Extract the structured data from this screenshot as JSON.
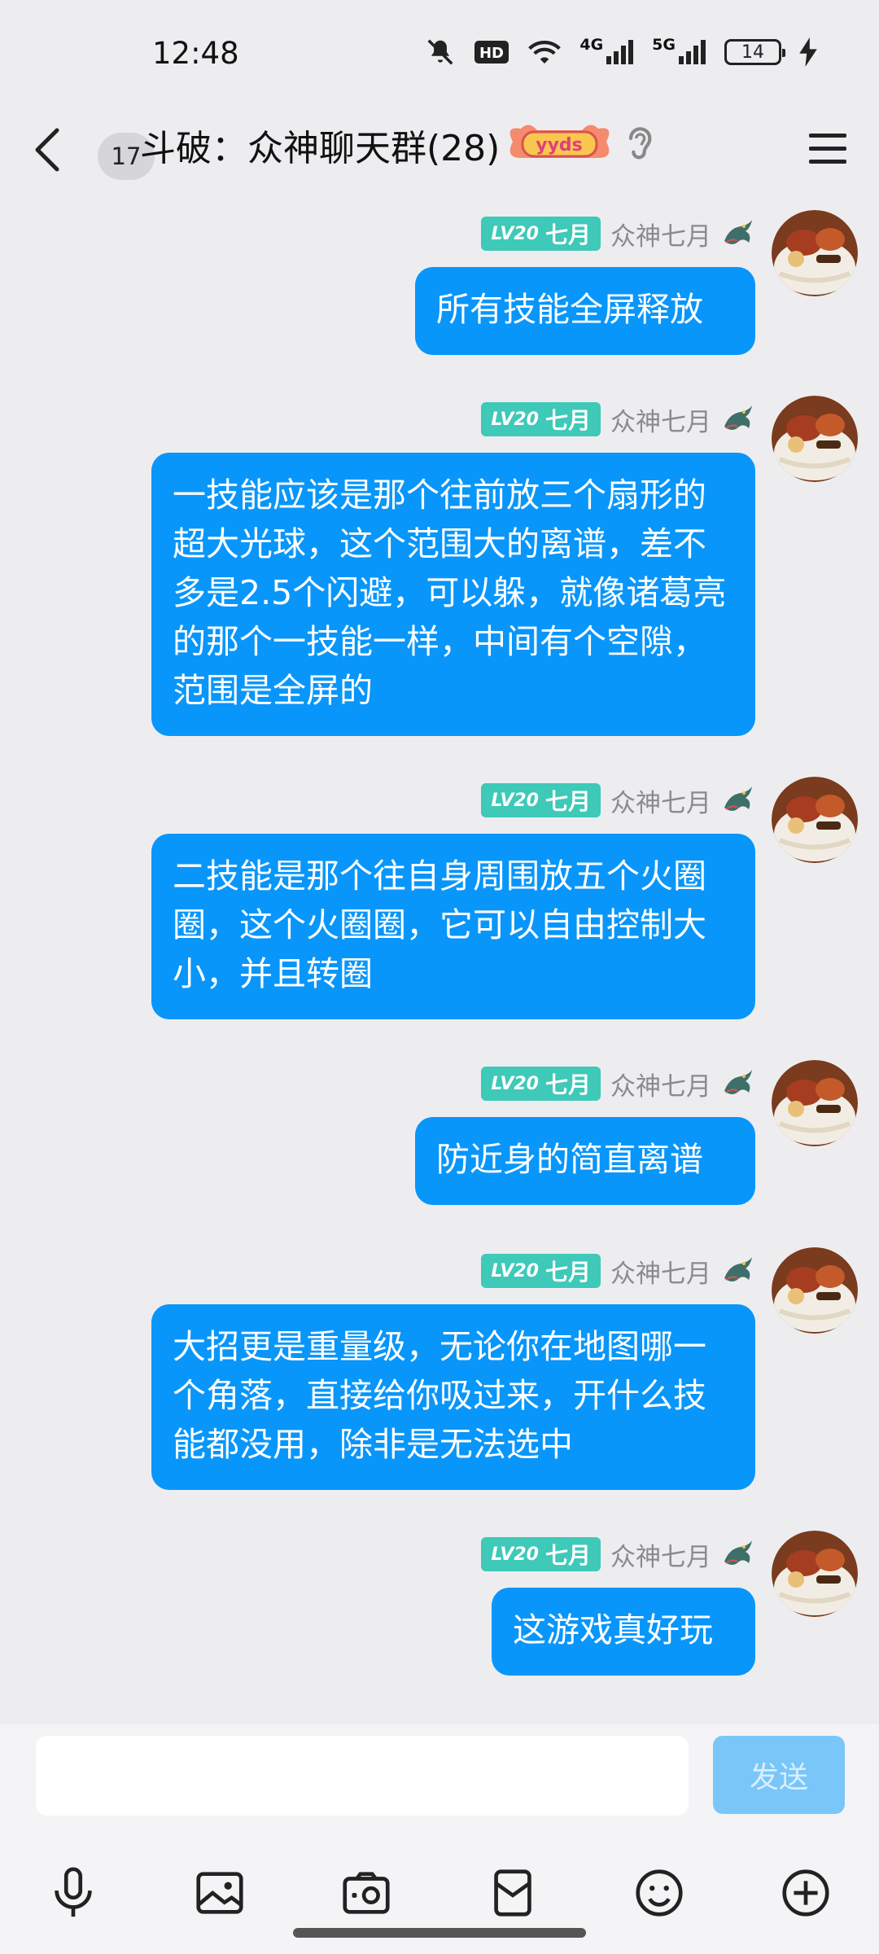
{
  "status_bar": {
    "time": "12:48",
    "icons": [
      "mute-icon",
      "hd-icon",
      "wifi-icon",
      "signal-4g-icon",
      "signal-5g-icon",
      "battery-icon",
      "charging-icon"
    ],
    "net1": "4G",
    "net2": "5G",
    "battery": "14"
  },
  "header": {
    "unread_count": "17",
    "title": "斗破：众神聊天群(28)",
    "badge_icon": "yyds-badge-icon",
    "ear_icon": "ear-icon",
    "menu_icon": "menu-icon"
  },
  "messages": [
    {
      "lv": "LV20",
      "title": "七月",
      "sender": "众神七月",
      "text": "所有技能全屏释放"
    },
    {
      "lv": "LV20",
      "title": "七月",
      "sender": "众神七月",
      "text": "一技能应该是那个往前放三个扇形的超大光球，这个范围大的离谱，差不多是2.5个闪避，可以躲，就像诸葛亮的那个一技能一样，中间有个空隙，范围是全屏的"
    },
    {
      "lv": "LV20",
      "title": "七月",
      "sender": "众神七月",
      "text": "二技能是那个往自身周围放五个火圈圈，这个火圈圈，它可以自由控制大小，并且转圈"
    },
    {
      "lv": "LV20",
      "title": "七月",
      "sender": "众神七月",
      "text": "防近身的简直离谱"
    },
    {
      "lv": "LV20",
      "title": "七月",
      "sender": "众神七月",
      "text": "大招更是重量级，无论你在地图哪一个角落，直接给你吸过来，开什么技能都没用，除非是无法选中"
    },
    {
      "lv": "LV20",
      "title": "七月",
      "sender": "众神七月",
      "text": "这游戏真好玩"
    }
  ],
  "input": {
    "placeholder": "",
    "send_label": "发送"
  },
  "toolbar": [
    "microphone-icon",
    "image-icon",
    "camera-icon",
    "red-packet-icon",
    "emoji-icon",
    "plus-icon"
  ],
  "colors": {
    "bubble": "#0896fb",
    "level_badge": "#3ec9b8",
    "send_disabled": "#7ac6f8",
    "background": "#ededf0"
  }
}
